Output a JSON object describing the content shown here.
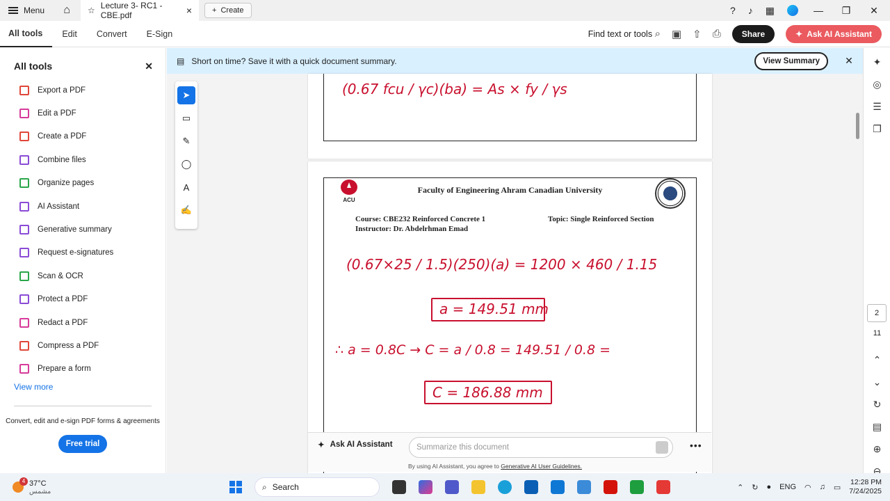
{
  "titlebar": {
    "menu_label": "Menu",
    "tab_title": "Lecture 3- RC1 - CBE.pdf",
    "create_label": "Create"
  },
  "toolbar": {
    "tabs": [
      "All tools",
      "Edit",
      "Convert",
      "E-Sign"
    ],
    "find_label": "Find text or tools",
    "share_label": "Share",
    "ai_label": "Ask AI Assistant"
  },
  "left_panel": {
    "title": "All tools",
    "items": [
      {
        "label": "Export a PDF",
        "color": "#e0463a"
      },
      {
        "label": "Edit a PDF",
        "color": "#d63b9a"
      },
      {
        "label": "Create a PDF",
        "color": "#e0463a"
      },
      {
        "label": "Combine files",
        "color": "#8a4bd6"
      },
      {
        "label": "Organize pages",
        "color": "#2ba64a"
      },
      {
        "label": "AI Assistant",
        "color": "#8a4bd6"
      },
      {
        "label": "Generative summary",
        "color": "#8a4bd6"
      },
      {
        "label": "Request e-signatures",
        "color": "#8a4bd6"
      },
      {
        "label": "Scan & OCR",
        "color": "#2ba64a"
      },
      {
        "label": "Protect a PDF",
        "color": "#8a4bd6"
      },
      {
        "label": "Redact a PDF",
        "color": "#d63b9a"
      },
      {
        "label": "Compress a PDF",
        "color": "#e0463a"
      },
      {
        "label": "Prepare a form",
        "color": "#d63b9a"
      }
    ],
    "view_more": "View more",
    "promo": "Convert, edit and e-sign PDF forms & agreements",
    "trial_label": "Free trial"
  },
  "banner": {
    "text": "Short on time? Save it with a quick document summary.",
    "button_label": "View Summary"
  },
  "document": {
    "page1_eq": "(0.67 fcu / γc)(ba) = As × fy / γs",
    "faculty": "Faculty of Engineering Ahram Canadian University",
    "course": "Course: CBE232 Reinforced Concrete 1",
    "instructor": "Instructor: Dr. Abdelrhman Emad",
    "topic": "Topic: Single Reinforced Section",
    "eq1": "(0.67×25 / 1.5)(250)(a) = 1200 × 460 / 1.15",
    "eq2": "a = 149.51 mm",
    "eq3": "∴ a = 0.8C → C = a / 0.8 = 149.51 / 0.8 =",
    "eq4": "C = 186.88 mm"
  },
  "right_rail": {
    "page_current": "2",
    "page_total": "11"
  },
  "ai_bar": {
    "label": "Ask AI Assistant",
    "placeholder": "Summarize this document",
    "note_prefix": "By using AI Assistant, you agree to",
    "note_link": "Generative AI User Guidelines."
  },
  "taskbar": {
    "weather_badge": "4",
    "temperature": "37°C",
    "condition": "مشمس",
    "search_label": "Search",
    "lang": "ENG",
    "time": "12:28 PM",
    "date": "7/24/2025"
  }
}
